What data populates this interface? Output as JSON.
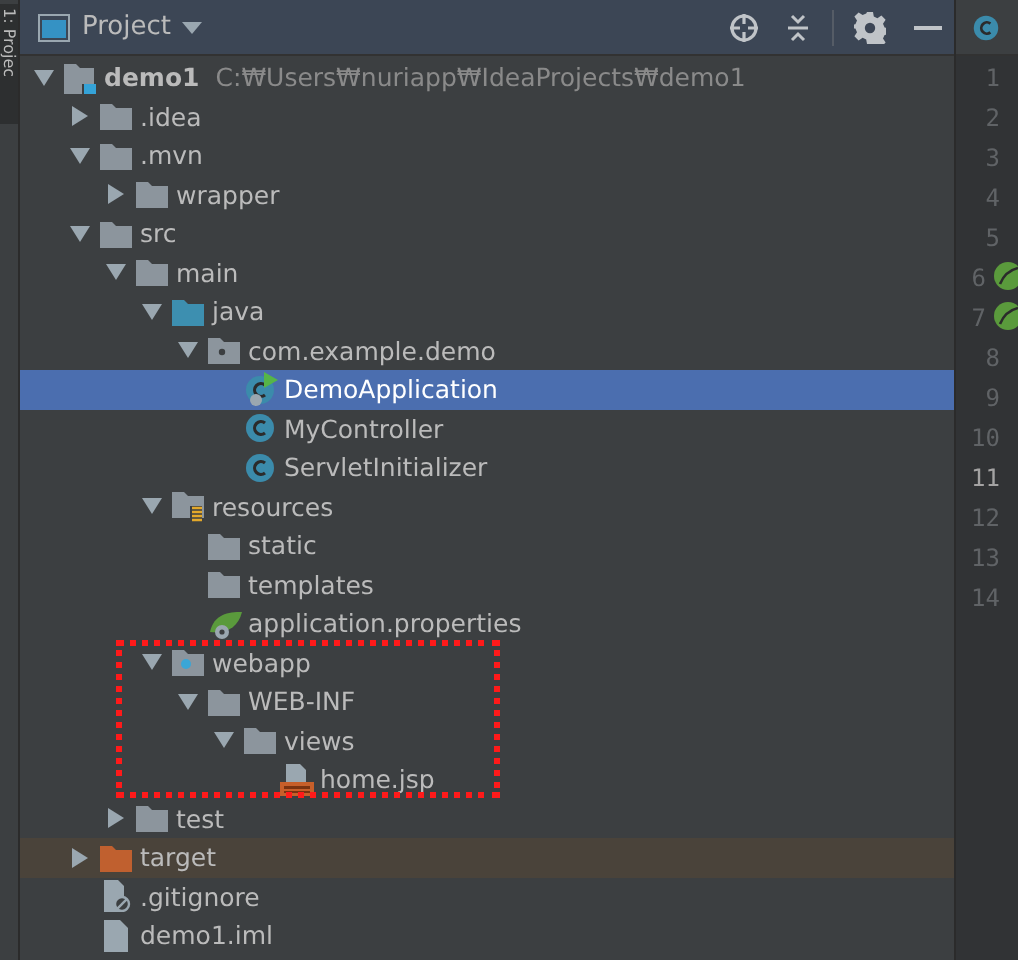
{
  "tool_stripe": {
    "label": "1: Projec"
  },
  "panel": {
    "title": "Project"
  },
  "tree": [
    {
      "name": "demo1",
      "kind": "module",
      "path": "C:₩Users₩nuriapp₩IdeaProjects₩demo1",
      "expanded": true,
      "selected": false,
      "children": [
        {
          "name": ".idea",
          "kind": "folder",
          "expanded": false,
          "selected": false
        },
        {
          "name": ".mvn",
          "kind": "folder",
          "expanded": true,
          "selected": false,
          "children": [
            {
              "name": "wrapper",
              "kind": "folder",
              "expanded": false,
              "selected": false
            }
          ]
        },
        {
          "name": "src",
          "kind": "folder",
          "expanded": true,
          "selected": false,
          "children": [
            {
              "name": "main",
              "kind": "folder",
              "expanded": true,
              "selected": false,
              "children": [
                {
                  "name": "java",
                  "kind": "sources",
                  "expanded": true,
                  "selected": false,
                  "children": [
                    {
                      "name": "com.example.demo",
                      "kind": "package",
                      "expanded": true,
                      "selected": false,
                      "children": [
                        {
                          "name": "DemoApplication",
                          "kind": "app",
                          "selected": true
                        },
                        {
                          "name": "MyController",
                          "kind": "class",
                          "selected": false
                        },
                        {
                          "name": "ServletInitializer",
                          "kind": "class",
                          "selected": false
                        }
                      ]
                    }
                  ]
                },
                {
                  "name": "resources",
                  "kind": "resources",
                  "expanded": true,
                  "selected": false,
                  "children": [
                    {
                      "name": "static",
                      "kind": "folder",
                      "selected": false
                    },
                    {
                      "name": "templates",
                      "kind": "folder",
                      "selected": false
                    },
                    {
                      "name": "application.properties",
                      "kind": "properties",
                      "selected": false
                    }
                  ]
                },
                {
                  "name": "webapp",
                  "kind": "web",
                  "expanded": true,
                  "selected": false,
                  "children": [
                    {
                      "name": "WEB-INF",
                      "kind": "folder",
                      "expanded": true,
                      "selected": false,
                      "children": [
                        {
                          "name": "views",
                          "kind": "folder",
                          "expanded": true,
                          "selected": false,
                          "children": [
                            {
                              "name": "home.jsp",
                              "kind": "jsp",
                              "selected": false
                            }
                          ]
                        }
                      ]
                    }
                  ]
                }
              ]
            },
            {
              "name": "test",
              "kind": "folder",
              "expanded": false,
              "selected": false
            }
          ]
        },
        {
          "name": "target",
          "kind": "excluded",
          "expanded": false,
          "selected": false
        },
        {
          "name": ".gitignore",
          "kind": "ignore",
          "selected": false
        },
        {
          "name": "demo1.iml",
          "kind": "file",
          "selected": false
        }
      ]
    }
  ],
  "editor": {
    "lines": [
      {
        "number": "1",
        "current": false,
        "bean": false
      },
      {
        "number": "2",
        "current": false,
        "bean": false
      },
      {
        "number": "3",
        "current": false,
        "bean": false
      },
      {
        "number": "4",
        "current": false,
        "bean": false
      },
      {
        "number": "5",
        "current": false,
        "bean": false
      },
      {
        "number": "6",
        "current": false,
        "bean": true
      },
      {
        "number": "7",
        "current": false,
        "bean": true
      },
      {
        "number": "8",
        "current": false,
        "bean": false
      },
      {
        "number": "9",
        "current": false,
        "bean": false
      },
      {
        "number": "10",
        "current": false,
        "bean": false
      },
      {
        "number": "11",
        "current": true,
        "bean": false
      },
      {
        "number": "12",
        "current": false,
        "bean": false
      },
      {
        "number": "13",
        "current": false,
        "bean": false
      },
      {
        "number": "14",
        "current": false,
        "bean": false
      }
    ]
  }
}
